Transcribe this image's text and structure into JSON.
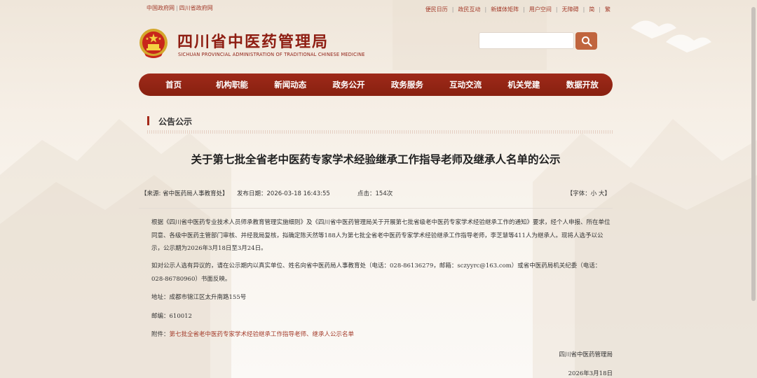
{
  "top_links_left": [
    "中国政府网",
    "四川省政府网"
  ],
  "top_links_right": [
    "便民日历",
    "政民互动",
    "新媒体矩阵",
    "用户空间",
    "无障碍",
    "简",
    "繁"
  ],
  "header": {
    "title": "四川省中医药管理局",
    "subtitle": "SICHUAN PROVINCIAL ADMINISTRATION OF TRADITIONAL CHINESE MEDICINE",
    "search_value": ""
  },
  "nav": [
    "首页",
    "机构职能",
    "新闻动态",
    "政务公开",
    "政务服务",
    "互动交流",
    "机关党建",
    "数据开放"
  ],
  "section_title": "公告公示",
  "article": {
    "title": "关于第七批全省老中医药专家学术经验继承工作指导老师及继承人名单的公示",
    "meta": {
      "source": "【来源:  省中医药局人事教育处】",
      "date": "发布日期：2026-03-18 16:43:55",
      "clicks": "点击：154次",
      "fontsize": "【字体：小 大】"
    },
    "para1": "根据《四川省中医药专业技术人员师承教育管理实施细则》及《四川省中医药管理局关于开展第七批省级老中医药专家学术经验继承工作的通知》要求，经个人申报、所在单位同意、各级中医药主管部门审核、并经我局复核，拟确定陈天然等188人为第七批全省老中医药专家学术经验继承工作指导老师，李芝慧等411人为继承人。现将人选予以公示，公示期为2026年3月18日至3月24日。",
    "para2": "如对公示人选有异议的，请在公示期内以真实单位、姓名向省中医药局人事教育处（电话：028-86136279，邮箱：sczyyrc@163.com）或省中医药局机关纪委（电话：028-86780960）书面反映。",
    "address": "地址：成都市锦江区太升南路155号",
    "postcode": "邮编：610012",
    "attachment_label": "附件：",
    "attachment_link": "第七批全省老中医药专家学术经验继承工作指导老师、继承人公示名单",
    "sign_org": "四川省中医药管理局",
    "sign_date": "2026年3月18日"
  },
  "colors": {
    "brand": "#8e1d12",
    "nav": "#9e2a1a",
    "search_button": "#c0653e"
  },
  "icons": [
    "national-emblem-icon",
    "search-icon"
  ]
}
